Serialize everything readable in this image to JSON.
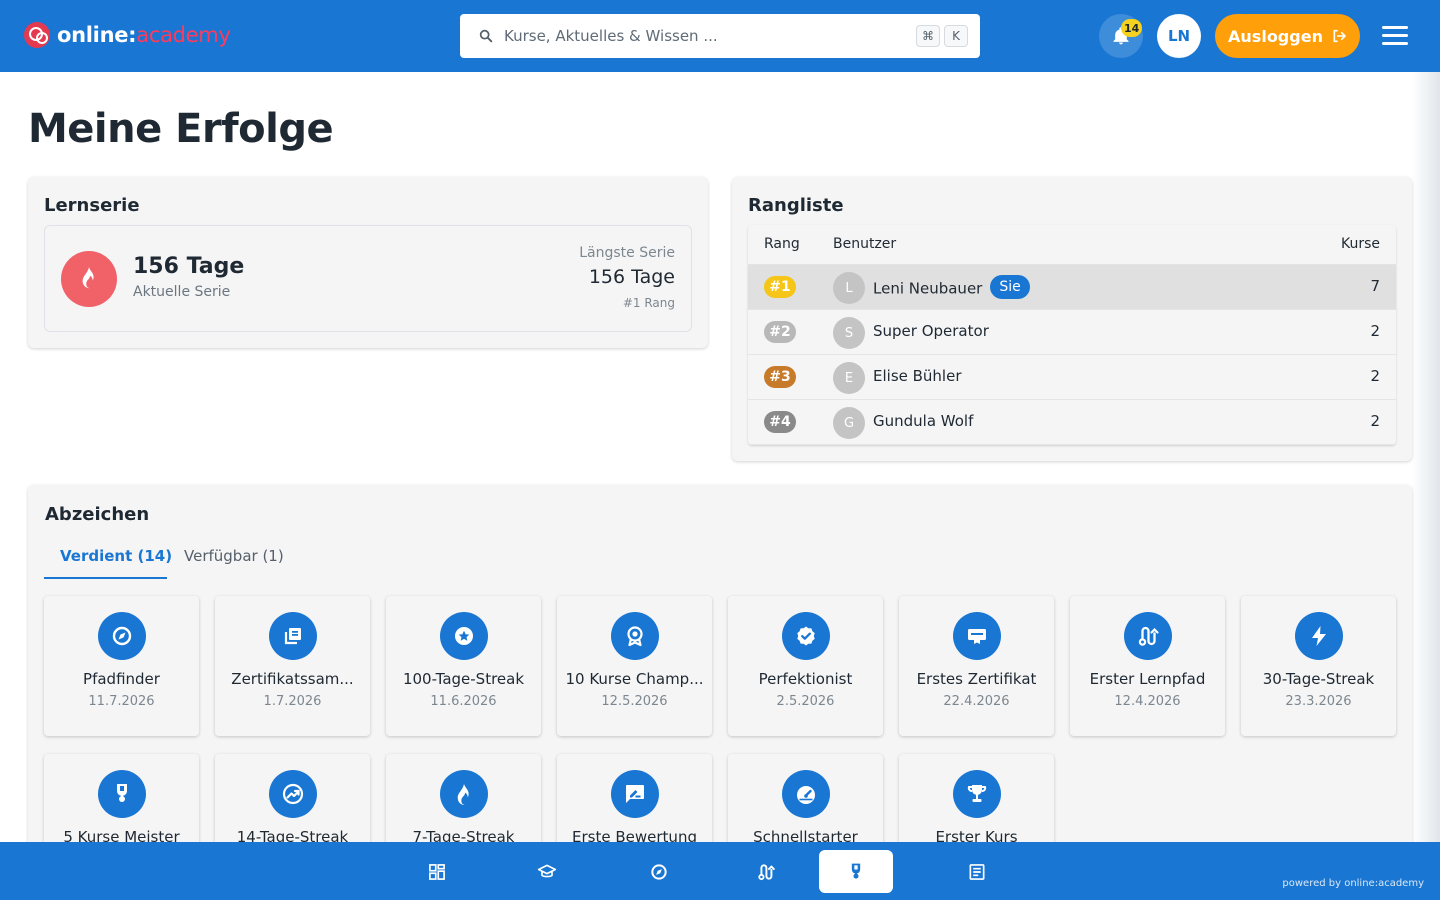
{
  "header": {
    "logo_main": "online:",
    "logo_accent": "academy",
    "search_placeholder": "Kurse, Aktuelles & Wissen ...",
    "shortcut_cmd": "⌘",
    "shortcut_key": "K",
    "notifications_count": "14",
    "user_initials": "LN",
    "logout_label": "Ausloggen"
  },
  "page": {
    "title": "Meine Erfolge"
  },
  "streak": {
    "title": "Lernserie",
    "current_value": "156 Tage",
    "current_label": "Aktuelle Serie",
    "longest_label": "Längste Serie",
    "longest_value": "156 Tage",
    "rank": "#1 Rang"
  },
  "leaderboard": {
    "title": "Rangliste",
    "columns": {
      "rank": "Rang",
      "user": "Benutzer",
      "courses": "Kurse"
    },
    "you_label": "Sie",
    "rows": [
      {
        "rank": "#1",
        "initial": "L",
        "name": "Leni Neubauer",
        "courses": "7",
        "badge_color": "#f5c518",
        "is_you": true
      },
      {
        "rank": "#2",
        "initial": "S",
        "name": "Super Operator",
        "courses": "2",
        "badge_color": "#b8b8b8",
        "is_you": false
      },
      {
        "rank": "#3",
        "initial": "E",
        "name": "Elise Bühler",
        "courses": "2",
        "badge_color": "#c77a2a",
        "is_you": false
      },
      {
        "rank": "#4",
        "initial": "G",
        "name": "Gundula Wolf",
        "courses": "2",
        "badge_color": "#8a8a8a",
        "is_you": false
      }
    ]
  },
  "badges": {
    "title": "Abzeichen",
    "tab_earned": "Verdient (14)",
    "tab_available": "Verfügbar (1)",
    "items": [
      {
        "name": "Pfadfinder",
        "date": "11.7.2026",
        "icon": "compass-icon"
      },
      {
        "name": "Zertifikatssam...",
        "date": "1.7.2026",
        "icon": "library-icon"
      },
      {
        "name": "100-Tage-Streak",
        "date": "11.6.2026",
        "icon": "star-icon"
      },
      {
        "name": "10 Kurse Champ...",
        "date": "12.5.2026",
        "icon": "award-icon"
      },
      {
        "name": "Perfektionist",
        "date": "2.5.2026",
        "icon": "verified-icon"
      },
      {
        "name": "Erstes Zertifikat",
        "date": "22.4.2026",
        "icon": "certificate-icon"
      },
      {
        "name": "Erster Lernpfad",
        "date": "12.4.2026",
        "icon": "route-icon"
      },
      {
        "name": "30-Tage-Streak",
        "date": "23.3.2026",
        "icon": "bolt-icon"
      },
      {
        "name": "5 Kurse Meister",
        "date": "",
        "icon": "medal-icon"
      },
      {
        "name": "14-Tage-Streak",
        "date": "",
        "icon": "trending-icon"
      },
      {
        "name": "7-Tage-Streak",
        "date": "",
        "icon": "flame-icon"
      },
      {
        "name": "Erste Bewertung",
        "date": "",
        "icon": "rate-review-icon"
      },
      {
        "name": "Schnellstarter",
        "date": "",
        "icon": "speed-icon"
      },
      {
        "name": "Erster Kurs",
        "date": "",
        "icon": "trophy-icon"
      }
    ]
  },
  "bottom_nav": {
    "items": [
      {
        "icon": "dashboard-icon",
        "active": false
      },
      {
        "icon": "school-icon",
        "active": false
      },
      {
        "icon": "compass-icon",
        "active": false
      },
      {
        "icon": "route-icon",
        "active": false
      },
      {
        "icon": "medal-icon",
        "active": true
      },
      {
        "icon": "article-icon",
        "active": false
      }
    ],
    "powered_by": "powered by online:academy"
  }
}
